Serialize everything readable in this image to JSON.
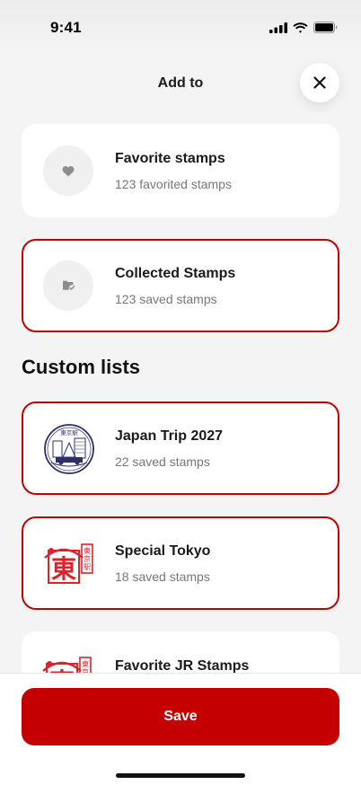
{
  "status_bar": {
    "time": "9:41",
    "icons": [
      "cellular-signal-icon",
      "wifi-icon",
      "battery-icon"
    ]
  },
  "header": {
    "title": "Add to",
    "close_icon": "close-icon"
  },
  "lists": [
    {
      "title": "Favorite stamps",
      "subtitle": "123 favorited stamps",
      "icon": "heart-icon",
      "selected": false
    },
    {
      "title": "Collected Stamps",
      "subtitle": "123 saved stamps",
      "icon": "folder-check-icon",
      "selected": true
    }
  ],
  "custom_lists_title": "Custom lists",
  "custom_lists": [
    {
      "title": "Japan Trip 2027",
      "subtitle": "22 saved stamps",
      "stamp": "blue-station-stamp",
      "selected": true
    },
    {
      "title": "Special Tokyo",
      "subtitle": "18 saved stamps",
      "stamp": "red-tokyo-stamp",
      "selected": true
    },
    {
      "title": "Favorite JR Stamps",
      "subtitle": "",
      "stamp": "red-tokyo-stamp",
      "selected": false
    }
  ],
  "save_label": "Save",
  "colors": {
    "accent": "#c40000",
    "background": "#f4f4f4",
    "card": "#ffffff",
    "subtitle": "#777777"
  }
}
